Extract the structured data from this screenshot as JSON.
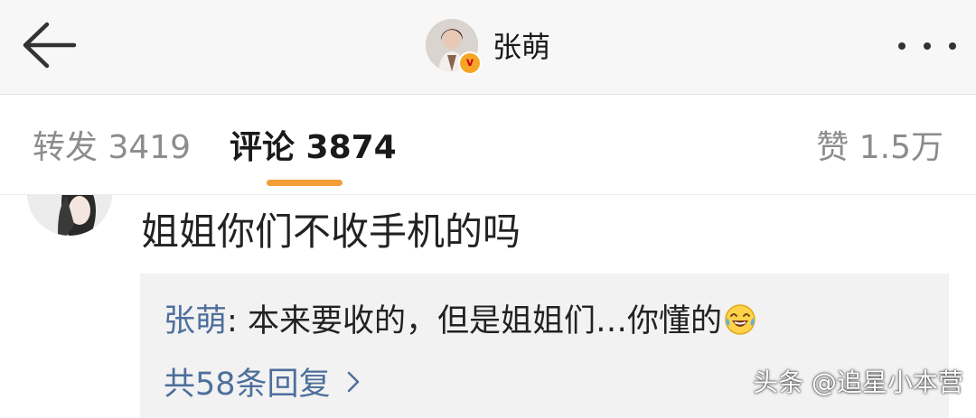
{
  "header": {
    "title": "张萌",
    "back_icon": "arrow-left-icon",
    "more_icon": "more-horizontal-icon",
    "badge_icon": "verified-v-icon",
    "badge_text": "v"
  },
  "tabs": {
    "repost": "转发 3419",
    "comments": "评论 3874",
    "likes": "赞 1.5万",
    "active": "comments",
    "indicator_color": "#f39c38"
  },
  "comment": {
    "text": "姐姐你们不收手机的吗",
    "reply": {
      "author": "张萌",
      "separator": ": ",
      "text": "本来要收的，但是姐姐们…你懂的",
      "emoji": "laughing-tears-emoji"
    },
    "more_replies": "共58条回复",
    "more_replies_icon": "chevron-right-icon"
  },
  "watermark": "头条 @追星小本营",
  "colors": {
    "link": "#4e6f9c",
    "accent": "#f39c38",
    "muted": "#8c8c8c"
  }
}
